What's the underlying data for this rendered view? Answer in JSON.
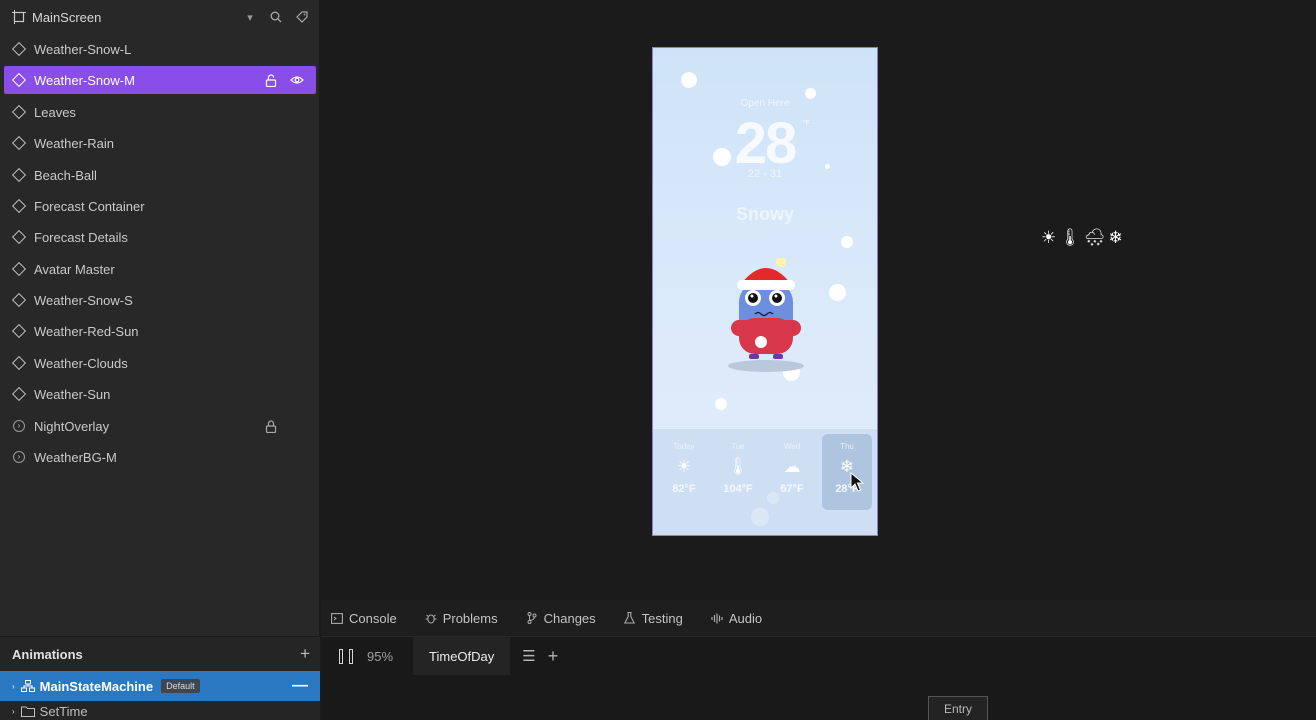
{
  "hierarchy": {
    "root": "MainScreen",
    "items": [
      {
        "label": "Weather-Snow-L",
        "type": "component"
      },
      {
        "label": "Weather-Snow-M",
        "type": "component",
        "selected": true
      },
      {
        "label": "Leaves",
        "type": "component"
      },
      {
        "label": "Weather-Rain",
        "type": "component"
      },
      {
        "label": "Beach-Ball",
        "type": "component"
      },
      {
        "label": "Forecast Container",
        "type": "component"
      },
      {
        "label": "Forecast Details",
        "type": "component"
      },
      {
        "label": "Avatar Master",
        "type": "component"
      },
      {
        "label": "Weather-Snow-S",
        "type": "component"
      },
      {
        "label": "Weather-Red-Sun",
        "type": "component"
      },
      {
        "label": "Weather-Clouds",
        "type": "component"
      },
      {
        "label": "Weather-Sun",
        "type": "component"
      },
      {
        "label": "NightOverlay",
        "type": "group",
        "locked": true
      },
      {
        "label": "WeatherBG-M",
        "type": "group"
      }
    ]
  },
  "artboard": {
    "city": "Open Here",
    "temperature": "28",
    "degree_unit": "°F",
    "range": "22 - 31",
    "condition": "Snowy",
    "forecast": [
      {
        "day": "Today",
        "icon": "☀",
        "temp": "82°F"
      },
      {
        "day": "Tue",
        "icon": "🌡",
        "temp": "104°F"
      },
      {
        "day": "Wed",
        "icon": "☁",
        "temp": "67°F"
      },
      {
        "day": "Thu",
        "icon": "❄",
        "temp": "28°F",
        "active": true
      }
    ]
  },
  "icon_strip": [
    "☀",
    "🌡",
    "🌨",
    "❄"
  ],
  "bottom_tabs": [
    {
      "label": "Console",
      "icon": "console-icon"
    },
    {
      "label": "Problems",
      "icon": "bug-icon"
    },
    {
      "label": "Changes",
      "icon": "branch-icon"
    },
    {
      "label": "Testing",
      "icon": "flask-icon"
    },
    {
      "label": "Audio",
      "icon": "audio-wave-icon"
    }
  ],
  "animations": {
    "title": "Animations",
    "state_machine": "MainStateMachine",
    "badge": "Default",
    "sub_item": "SetTime"
  },
  "timeline": {
    "zoom": "95%",
    "tab": "TimeOfDay",
    "entry_node": "Entry"
  },
  "colors": {
    "selection": "#8a4ee8",
    "state_machine_row": "#2b78c2",
    "artboard_border": "#8c7ee9"
  }
}
